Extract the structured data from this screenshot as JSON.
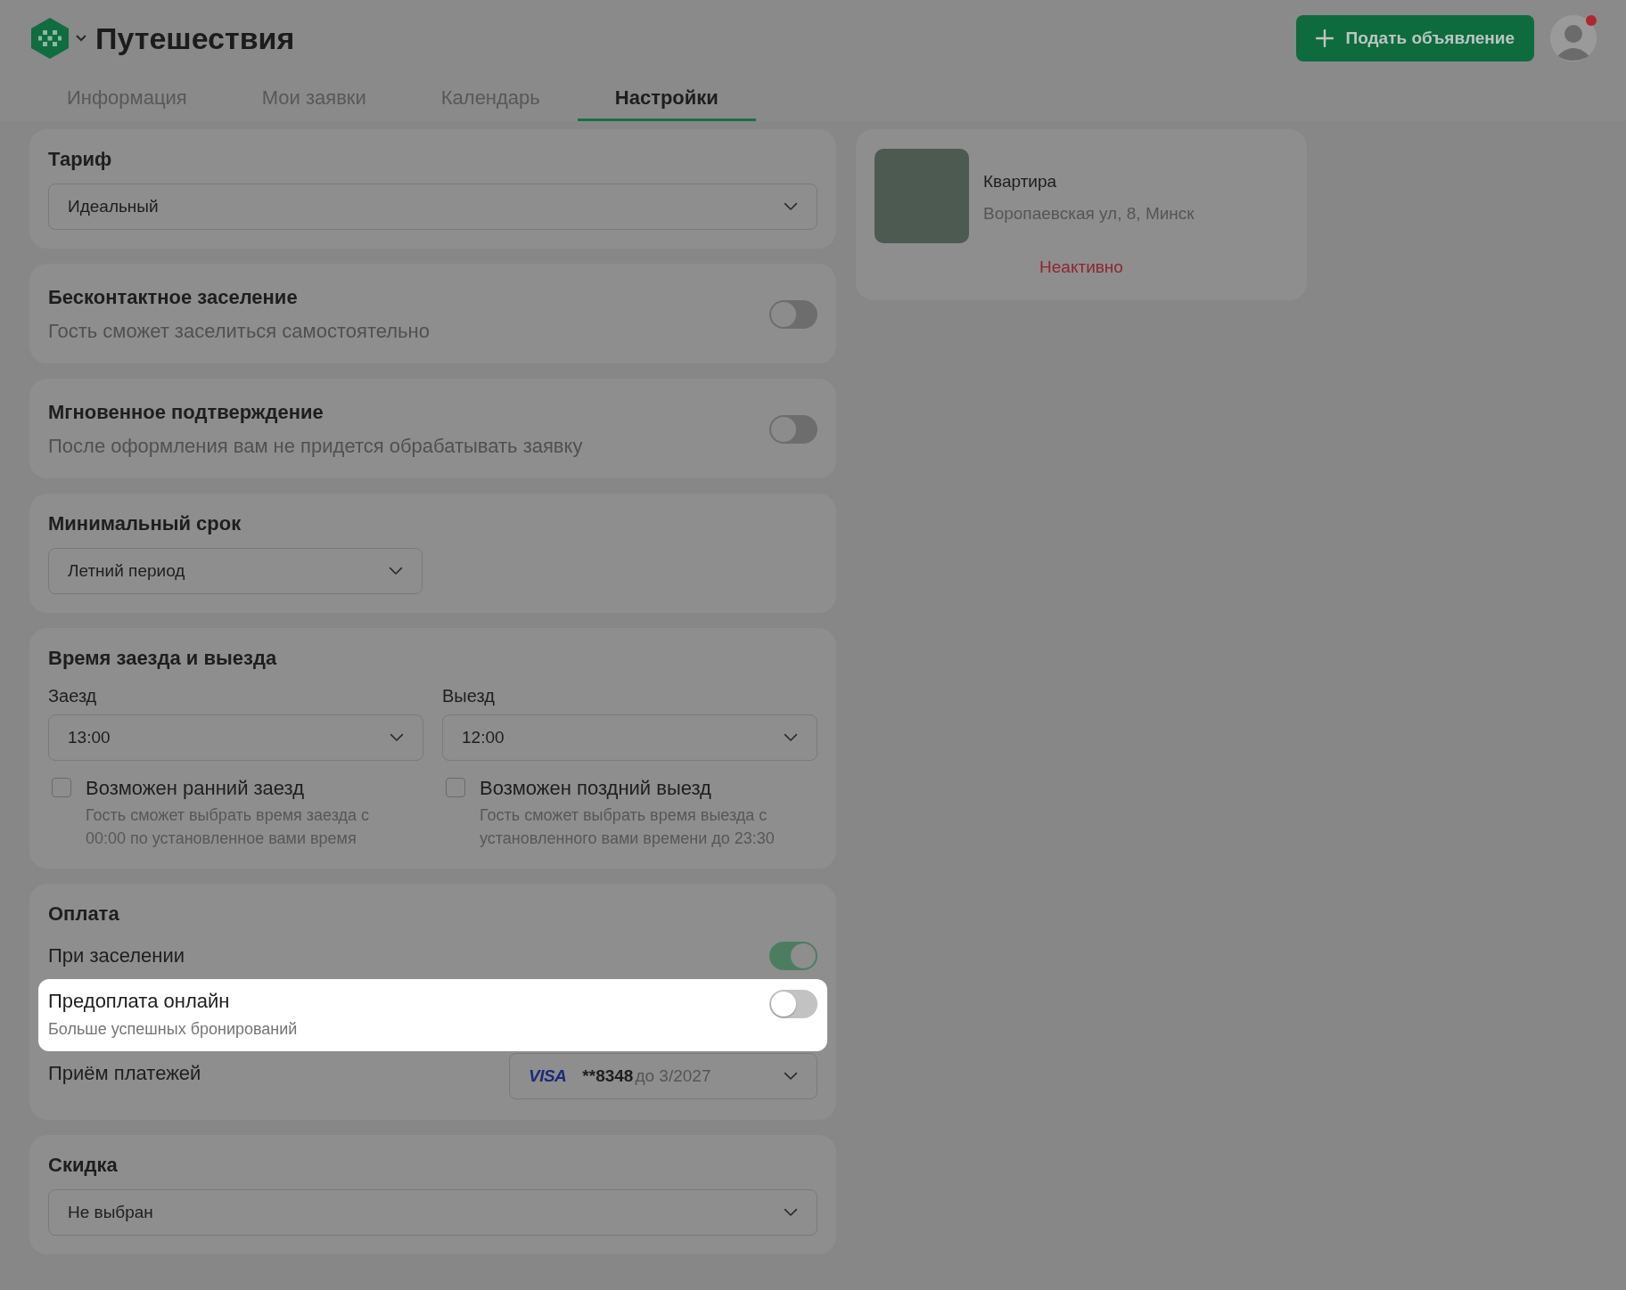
{
  "header": {
    "title": "Путешествия",
    "post_button": "Подать объявление",
    "avatar": {
      "notification": true
    },
    "tabs": [
      {
        "label": "Информация",
        "selected": false
      },
      {
        "label": "Мои заявки",
        "selected": false
      },
      {
        "label": "Календарь",
        "selected": false
      },
      {
        "label": "Настройки",
        "selected": true
      }
    ]
  },
  "sections": [
    {
      "kind": "select",
      "title": "Тариф",
      "value": "Идеальный"
    },
    {
      "kind": "toggle",
      "title": "Бесконтактное заселение",
      "description": "Гость сможет заселиться самостоятельно",
      "on": false
    },
    {
      "kind": "toggle",
      "title": "Мгновенное подтверждение",
      "description": "После оформления вам не придется обрабатывать заявку",
      "on": false
    },
    {
      "kind": "short_select",
      "title": "Минимальный срок",
      "value": "Летний период"
    },
    {
      "kind": "times",
      "title": "Время заезда и выезда",
      "columns": [
        {
          "label": "Заезд",
          "value": "13:00",
          "option": {
            "label": "Возможен ранний заезд",
            "description": "Гость сможет выбрать время заезда с 00:00 по установленное вами время",
            "checked": false
          }
        },
        {
          "label": "Выезд",
          "value": "12:00",
          "option": {
            "label": "Возможен поздний выезд",
            "description": "Гость сможет выбрать время выезда с установленного вами времени до 23:30",
            "checked": false
          }
        }
      ]
    },
    {
      "kind": "payment",
      "title": "Оплата",
      "options": [
        {
          "label": "При заселении",
          "on": true,
          "highlighted": false
        },
        {
          "label": "Предоплата онлайн",
          "description": "Больше успешных бронирований",
          "on": false,
          "highlighted": true
        }
      ],
      "receiving": {
        "label": "Приём платежей",
        "card_brand": "VISA",
        "card_number": "**8348",
        "expiry": "до 3/2027"
      }
    },
    {
      "kind": "select",
      "title": "Скидка",
      "value": "Не выбран"
    }
  ],
  "listing": {
    "title": "Квартира",
    "address": "Воропаевская ул, 8, Минск",
    "status": "Неактивно"
  }
}
